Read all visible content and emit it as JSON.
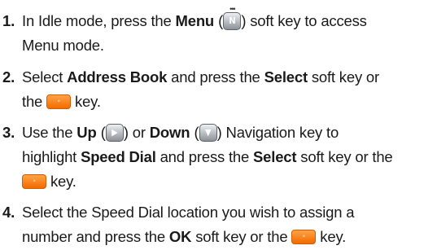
{
  "steps": [
    {
      "number": "1.",
      "lines": [
        [
          "In Idle mode, press the ",
          "Menu",
          " (",
          ") soft key to access"
        ],
        [
          "Menu mode."
        ]
      ]
    },
    {
      "number": "2.",
      "lines": [
        [
          "Select ",
          "Address Book",
          " and press the ",
          "Select",
          " soft key or"
        ],
        [
          "the ",
          " key."
        ]
      ]
    },
    {
      "number": "3.",
      "lines": [
        [
          "Use the ",
          "Up",
          " (",
          ") or ",
          "Down",
          " (",
          ") Navigation key to"
        ],
        [
          "highlight ",
          "Speed Dial",
          " and press the ",
          "Select",
          " soft key or the"
        ],
        [
          " key."
        ]
      ]
    },
    {
      "number": "4.",
      "lines": [
        [
          "Select the Speed Dial location you wish to assign a"
        ],
        [
          "number and press the ",
          "OK",
          " soft key or the ",
          " key."
        ]
      ]
    }
  ],
  "icons": {
    "menu_key": {
      "name": "menu-key-icon",
      "glyph": "N"
    },
    "up_key": {
      "name": "up-navigation-key-icon",
      "glyph": "▶"
    },
    "down_key": {
      "name": "down-navigation-key-icon",
      "glyph": "▼"
    },
    "send_key": {
      "name": "send-key-icon",
      "glyph": "◦",
      "color": "#f47a10"
    }
  }
}
